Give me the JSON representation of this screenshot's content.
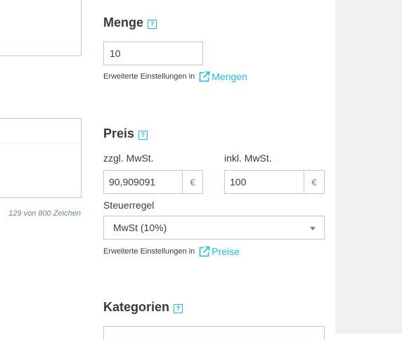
{
  "sidebar_panel": {},
  "left": {
    "char_count": "129 von 800 Zeichen"
  },
  "quantity": {
    "title": "Menge",
    "help_glyph": "?",
    "value": "10",
    "advanced_prefix": "Erweiterte Einstellungen in",
    "advanced_link": "Mengen"
  },
  "price": {
    "title": "Preis",
    "help_glyph": "?",
    "excl_label": "zzgl. MwSt.",
    "excl_value": "90,909091",
    "incl_label": "inkl. MwSt.",
    "incl_value": "100",
    "currency": "€",
    "tax_rule_label": "Steuerregel",
    "tax_rule_value": "MwSt (10%)",
    "advanced_prefix": "Erweiterte Einstellungen in",
    "advanced_link": "Preise"
  },
  "categories": {
    "title": "Kategorien",
    "help_glyph": "?"
  },
  "colors": {
    "accent": "#25b9d7",
    "border": "#bbcdd2",
    "text": "#363a41",
    "panel": "#eff1f2"
  },
  "icons": {
    "help": "help-icon",
    "external_link": "external-link-icon",
    "dropdown": "chevron-down-icon"
  }
}
